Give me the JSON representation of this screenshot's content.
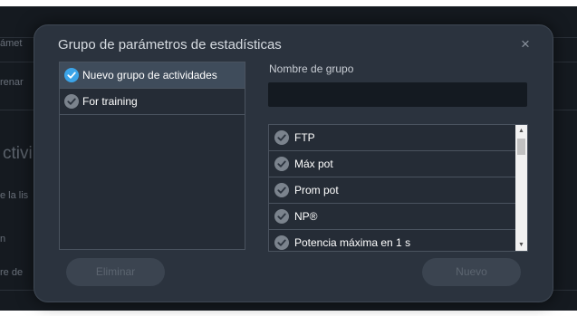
{
  "background": {
    "rows": [
      "ámet",
      "renar",
      "ctivi",
      "e la lis",
      "n",
      "re de"
    ]
  },
  "dialog": {
    "title": "Grupo de parámetros de estadísticas",
    "close_glyph": "×",
    "groups": [
      {
        "label": "Nuevo grupo de actividades",
        "selected": true
      },
      {
        "label": "For training",
        "selected": false
      }
    ],
    "name_field": {
      "label": "Nombre de grupo",
      "value": "",
      "placeholder": ""
    },
    "stats": [
      {
        "label": "FTP"
      },
      {
        "label": "Máx pot"
      },
      {
        "label": "Prom pot"
      },
      {
        "label": "NP®"
      },
      {
        "label": "Potencia máxima en 1 s"
      }
    ],
    "buttons": {
      "delete": "Eliminar",
      "new": "Nuevo"
    }
  },
  "colors": {
    "check_selected": "#3ba4e8",
    "check_default": "#7b838d",
    "dialog_bg": "#2b333e",
    "accent_selection": "#3f4c5b"
  },
  "icons": {
    "check": "check-circle-icon",
    "close": "close-icon",
    "up": "arrow-up-icon",
    "down": "arrow-down-icon"
  }
}
